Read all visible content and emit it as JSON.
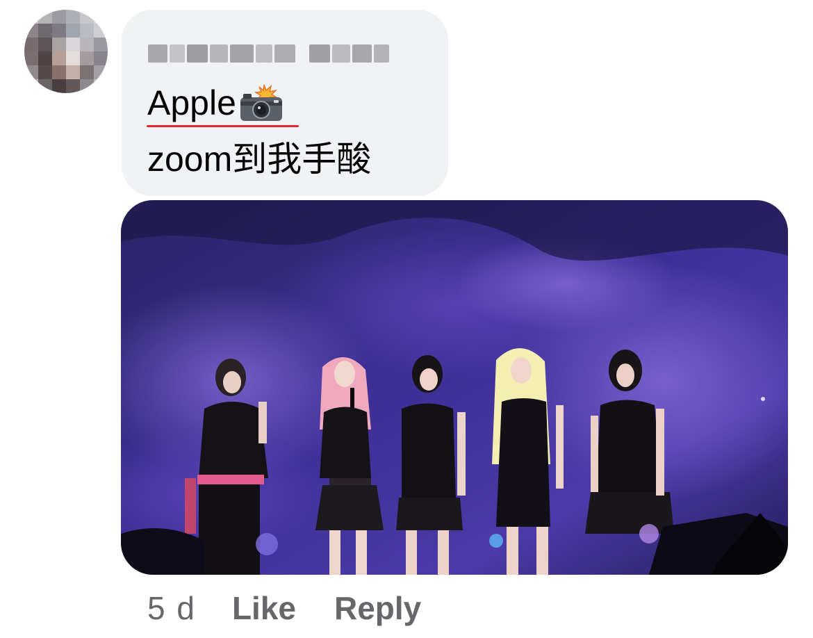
{
  "comment": {
    "author_name": "",
    "avatar_icon": "blurred-avatar",
    "line1_text": "Apple",
    "line1_emoji": "camera-with-flash-icon",
    "line2_text": "zoom到我手酸",
    "photo_icon": "concert-stage-photo"
  },
  "actions": {
    "timestamp": "5 d",
    "like_label": "Like",
    "reply_label": "Reply"
  },
  "colors": {
    "bubble_bg": "#f0f2f5",
    "text": "#050505",
    "meta_text": "#65676b",
    "spellcheck_underline": "#e4262b",
    "photo_bg": "#3b2f8a"
  }
}
